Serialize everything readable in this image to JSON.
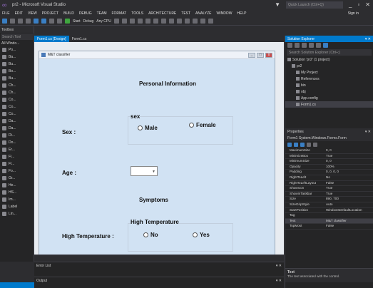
{
  "titlebar": {
    "title": "pr2 - Microsoft Visual Studio",
    "quick_launch": "Quick Launch (Ctrl+Q)"
  },
  "menu": {
    "items": [
      "FILE",
      "EDIT",
      "VIEW",
      "PROJECT",
      "BUILD",
      "DEBUG",
      "TEAM",
      "FORMAT",
      "TOOLS",
      "ARCHITECTURE",
      "TEST",
      "ANALYZE",
      "WINDOW",
      "HELP"
    ],
    "sign_in": "Sign in"
  },
  "toolbar": {
    "start": "Start",
    "config": "Debug",
    "platform": "Any CPU"
  },
  "toolbox": {
    "header": "Toolbox",
    "search": "Search Tool",
    "group": "All Windo...",
    "items": [
      "Po...",
      "Ba...",
      "Bu...",
      "Bo...",
      "Bu...",
      "Ch...",
      "Ch...",
      "Co...",
      "Co...",
      "Co...",
      "Da...",
      "Da...",
      "Di...",
      "Do...",
      "Er...",
      "Fi...",
      "Fl...",
      "Fo...",
      "Gr...",
      "He...",
      "HS...",
      "Im...",
      "Label",
      "Lin..."
    ]
  },
  "doctabs": {
    "tabs": [
      "Form1.cs [Design]",
      "Form1.cs"
    ]
  },
  "form": {
    "title": "M&T classifier",
    "personal_info": "Personal Information",
    "sex_group_title": "sex",
    "sex_label": "Sex :",
    "male": "Male",
    "female": "Female",
    "age_label": "Age :",
    "symptoms": "Symptoms",
    "temp_group_title": "High Temperature",
    "temp_label": "High Temperature :",
    "no": "No",
    "yes": "Yes"
  },
  "solution_explorer": {
    "header": "Solution Explorer",
    "search": "Search Solution Explorer (Ctrl+;)",
    "tree": [
      {
        "label": "Solution 'pr2' (1 project)",
        "indent": 0
      },
      {
        "label": "pr2",
        "indent": 1
      },
      {
        "label": "My Project",
        "indent": 2
      },
      {
        "label": "References",
        "indent": 2
      },
      {
        "label": "bin",
        "indent": 2
      },
      {
        "label": "obj",
        "indent": 2
      },
      {
        "label": "App.config",
        "indent": 2
      },
      {
        "label": "Form1.cs",
        "indent": 2
      }
    ]
  },
  "properties": {
    "header": "Properties",
    "object": "Form1 System.Windows.Forms.Form",
    "rows": [
      {
        "name": "MaximumSize",
        "value": "0, 0"
      },
      {
        "name": "MinimizeBox",
        "value": "True"
      },
      {
        "name": "MinimumSize",
        "value": "0, 0"
      },
      {
        "name": "Opacity",
        "value": "100%"
      },
      {
        "name": "Padding",
        "value": "0, 0, 0, 0"
      },
      {
        "name": "RightToLeft",
        "value": "No"
      },
      {
        "name": "RightToLeftLayout",
        "value": "False"
      },
      {
        "name": "ShowIcon",
        "value": "True"
      },
      {
        "name": "ShowInTaskbar",
        "value": "True"
      },
      {
        "name": "Size",
        "value": "890, 700"
      },
      {
        "name": "SizeGripStyle",
        "value": "Auto"
      },
      {
        "name": "StartPosition",
        "value": "WindowsDefaultLocation"
      },
      {
        "name": "Tag",
        "value": ""
      },
      {
        "name": "Text",
        "value": "M&T classifier"
      },
      {
        "name": "TopMost",
        "value": "False"
      }
    ],
    "desc_name": "Text",
    "desc_text": "The text associated with the control."
  },
  "bottom": {
    "error_list": "Error List",
    "output": "Output"
  },
  "colors": {
    "accent": "#007acc",
    "form_bg": "#d1e2f3"
  }
}
